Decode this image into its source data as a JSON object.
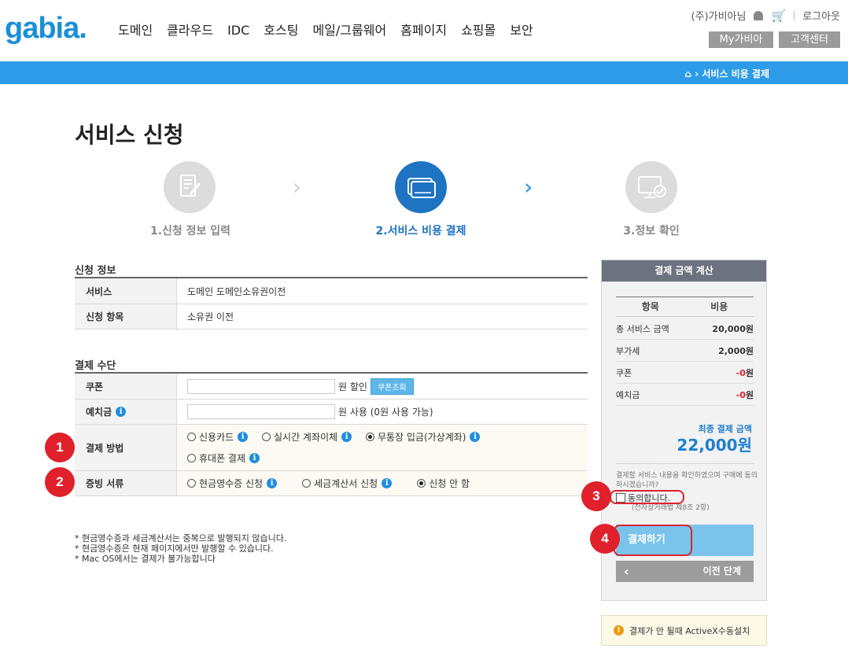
{
  "header": {
    "logo": "gabia.",
    "nav": [
      "도메인",
      "클라우드",
      "IDC",
      "호스팅",
      "메일/그룹웨어",
      "홈페이지",
      "쇼핑몰",
      "보안"
    ],
    "user": "(주)가비아님",
    "logout": "로그아웃",
    "my_gabia": "My가비아",
    "support": "고객센터"
  },
  "breadcrumb": "서비스 비용 결제",
  "page_title": "서비스 신청",
  "steps": [
    {
      "label": "1.신청 정보 입력",
      "state": "done"
    },
    {
      "label": "2.서비스 비용 결제",
      "state": "active"
    },
    {
      "label": "3.정보 확인",
      "state": "pending"
    }
  ],
  "application_info": {
    "title": "신청 정보",
    "rows": [
      {
        "label": "서비스",
        "value": "도메인 도메인소유권이전"
      },
      {
        "label": "신청 항목",
        "value": "소유권 이전"
      }
    ]
  },
  "payment": {
    "title": "결제 수단",
    "coupon_label": "쿠폰",
    "coupon_suffix": "원 할인",
    "coupon_button": "쿠폰조회",
    "deposit_label": "예치금",
    "deposit_suffix": "원 사용 (0원 사용 가능)",
    "method_label": "결제 방법",
    "methods": [
      "신용카드",
      "실시간 계좌이체",
      "무통장 입금(가상계좌)",
      "휴대폰 결제"
    ],
    "selected_method": "무통장 입금(가상계좌)",
    "receipt_label": "증빙 서류",
    "receipts": [
      "현금영수증 신청",
      "세금계산서 신청",
      "신청 안 함"
    ],
    "selected_receipt": "신청 안 함"
  },
  "notes": [
    "* 현금영수증과 세금계산서는 중복으로 발행되지 않습니다.",
    "* 현금영수증은 현재 페이지에서만 발행할 수 있습니다.",
    "* Mac OS에서는 결제가 불가능합니다"
  ],
  "summary": {
    "title": "결제 금액 계산",
    "col_item": "항목",
    "col_cost": "비용",
    "rows": [
      {
        "label": "총 서비스 금액",
        "value": "20,000원"
      },
      {
        "label": "부가세",
        "value": "2,000원"
      },
      {
        "label": "쿠폰",
        "value_red": "-0",
        "value_unit": "원"
      },
      {
        "label": "예치금",
        "value_red": "-0",
        "value_unit": "원"
      }
    ],
    "final_label": "최종 결제 금액",
    "final_value": "22,000원",
    "agree_note": "결제할 서비스 내용을 확인하였으며 구매에 동의하시겠습니까?",
    "agree_label": "동의합니다.",
    "law_note": "(전자상거래법 제8조 2항)",
    "pay_button": "결제하기",
    "prev_button": "이전 단계"
  },
  "activex": "결제가 안 될때 ActiveX수동설치",
  "badges": [
    "1",
    "2",
    "3",
    "4"
  ],
  "colors": {
    "brand_blue": "#2e9be8",
    "step_active": "#1e73c2",
    "badge_red": "#e0202b"
  }
}
